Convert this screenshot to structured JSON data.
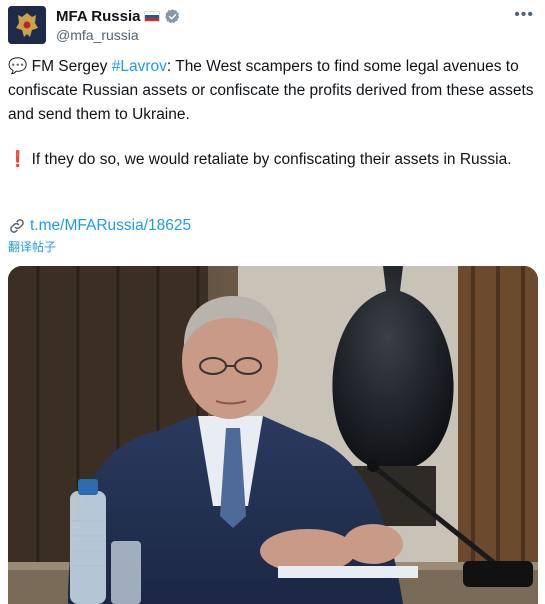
{
  "author": {
    "display_name": "MFA Russia",
    "handle": "@mfa_russia",
    "flag_icon": "russia-flag-icon",
    "verified_icon": "verified-badge-icon",
    "verified_color": "#829aab"
  },
  "tweet": {
    "para1_emoji": "💬",
    "para1_prefix": " FM Sergey ",
    "hashtag": "#Lavrov",
    "para1_rest": ": The West scampers to find some legal avenues to confiscate Russian assets or confiscate the profits derived from these assets and send them to Ukraine.",
    "para2_emoji": "❗",
    "para2_text": " If they do so, we would retaliate by confiscating their assets in Russia.",
    "link_icon": "link-icon",
    "link_text": "t.me/MFARussia/18625",
    "translate_label": "翻译帖子"
  },
  "colors": {
    "link": "#1d9bf0",
    "text": "#0f1419",
    "secondary": "#536471"
  }
}
